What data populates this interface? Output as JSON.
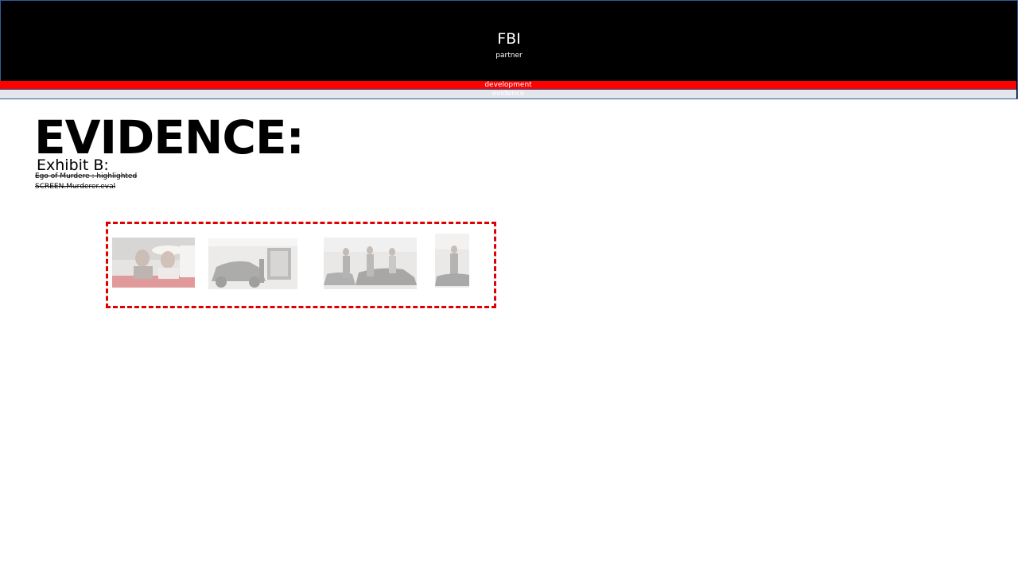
{
  "header": {
    "title": "FBI",
    "subtitle": "partner"
  },
  "bands": {
    "red_label": "development",
    "grey_label": "evidence"
  },
  "main": {
    "title": "EVIDENCE:",
    "exhibit": "Exhibit B:",
    "notes": [
      "Ego of Murdere : highlighted",
      "SCREEN.Murderer.eval"
    ]
  },
  "evidence_images": [
    "photo-icon",
    "photo-icon",
    "photo-icon",
    "photo-icon"
  ],
  "colors": {
    "header_bg": "#000000",
    "accent_red": "#ff0000",
    "band_grey": "#e4e6ec",
    "box_border": "#e00000"
  }
}
